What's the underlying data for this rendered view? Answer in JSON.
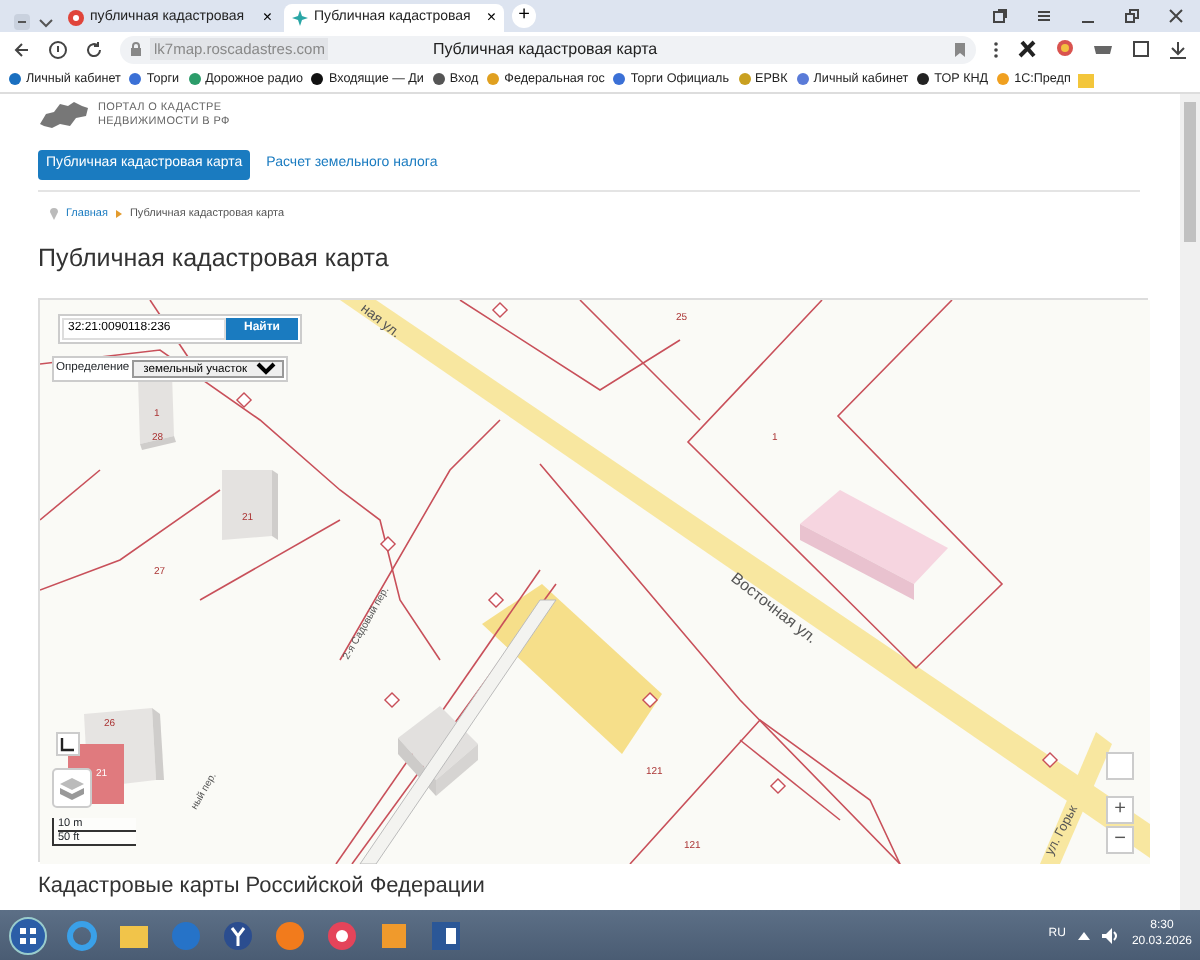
{
  "browser": {
    "tabs": [
      {
        "title": "публичная кадастровая",
        "close": "×",
        "selected": false
      },
      {
        "title": "Публичная кадастровая",
        "close": "×",
        "selected": true
      }
    ],
    "new_tab": "+",
    "address_bar": {
      "url": "lk7map.roscadastres.com",
      "page_title": "Публичная кадастровая карта"
    },
    "bookmarks": [
      "Личный кабинет",
      "Торги",
      "Дорожное радио",
      "Входящие — Ди",
      "Вход",
      "Федеральная гос",
      "Торги Официаль",
      "ЕРВК",
      "Личный кабинет",
      "ТОР КНД",
      "1С:Предп"
    ]
  },
  "page": {
    "logo_text": [
      "ПОРТАЛ О КАДАСТРЕ",
      "НЕДВИЖИМОСТИ В РФ"
    ],
    "nav_tabs": [
      {
        "label": "Публичная кадастровая карта",
        "selected": true
      },
      {
        "label": "Расчет земельного налога",
        "selected": false
      }
    ],
    "breadcrumb": [
      "Главная",
      "Публичная кадастровая карта"
    ],
    "heading": "Публичная кадастровая карта",
    "map": {
      "search_value": "32:21:0090118:236",
      "search_button": "Найти",
      "mode_label": "Определение",
      "mode_value": "земельный участок",
      "streets": [
        "ная ул.",
        "Восточная ул.",
        "2-я Садовый пер.",
        "ный пер.",
        "ул. Горьк"
      ],
      "parcel_numbers": [
        "25",
        "1",
        "1",
        "28",
        "21",
        "27",
        "26",
        "21",
        "121",
        "121"
      ],
      "scale": [
        "10 m",
        "50 ft"
      ],
      "zoom_in": "+",
      "zoom_out": "−"
    },
    "section_heading": "Кадастровые карты Российской Федерации"
  },
  "taskbar": {
    "language": "RU",
    "time": "8:30",
    "date": "20.03.2026"
  }
}
